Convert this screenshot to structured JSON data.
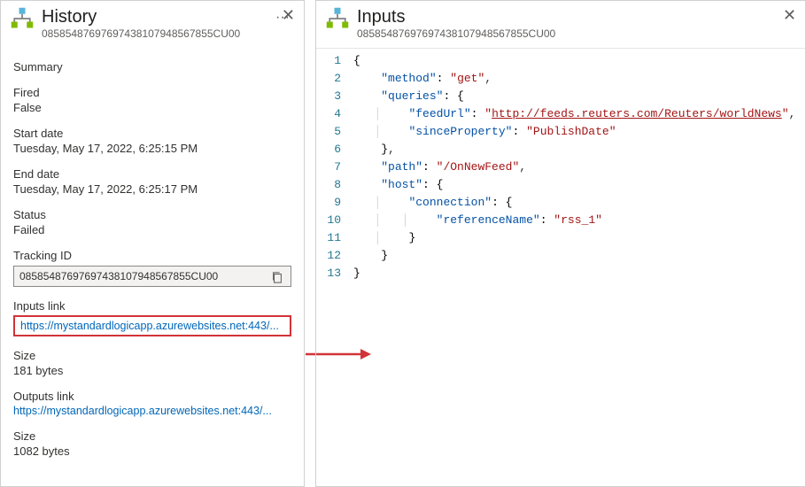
{
  "history": {
    "title": "History",
    "subtitle": "08585487697697438107948567855CU00",
    "summary_label": "Summary",
    "fired_label": "Fired",
    "fired_value": "False",
    "start_label": "Start date",
    "start_value": "Tuesday, May 17, 2022, 6:25:15 PM",
    "end_label": "End date",
    "end_value": "Tuesday, May 17, 2022, 6:25:17 PM",
    "status_label": "Status",
    "status_value": "Failed",
    "tracking_label": "Tracking ID",
    "tracking_value": "08585487697697438107948567855CU00",
    "inputs_link_label": "Inputs link",
    "inputs_link_value": "https://mystandardlogicapp.azurewebsites.net:443/...",
    "inputs_size_label": "Size",
    "inputs_size_value": "181 bytes",
    "outputs_link_label": "Outputs link",
    "outputs_link_value": "https://mystandardlogicapp.azurewebsites.net:443/...",
    "outputs_size_label": "Size",
    "outputs_size_value": "1082 bytes"
  },
  "inputs": {
    "title": "Inputs",
    "subtitle": "08585487697697438107948567855CU00",
    "json": {
      "method": "get",
      "queries": {
        "feedUrl": "http://feeds.reuters.com/Reuters/worldNews",
        "sinceProperty": "PublishDate"
      },
      "path": "/OnNewFeed",
      "host": {
        "connection": {
          "referenceName": "rss_1"
        }
      }
    },
    "line_numbers": [
      1,
      2,
      3,
      4,
      5,
      6,
      7,
      8,
      9,
      10,
      11,
      12,
      13
    ]
  }
}
